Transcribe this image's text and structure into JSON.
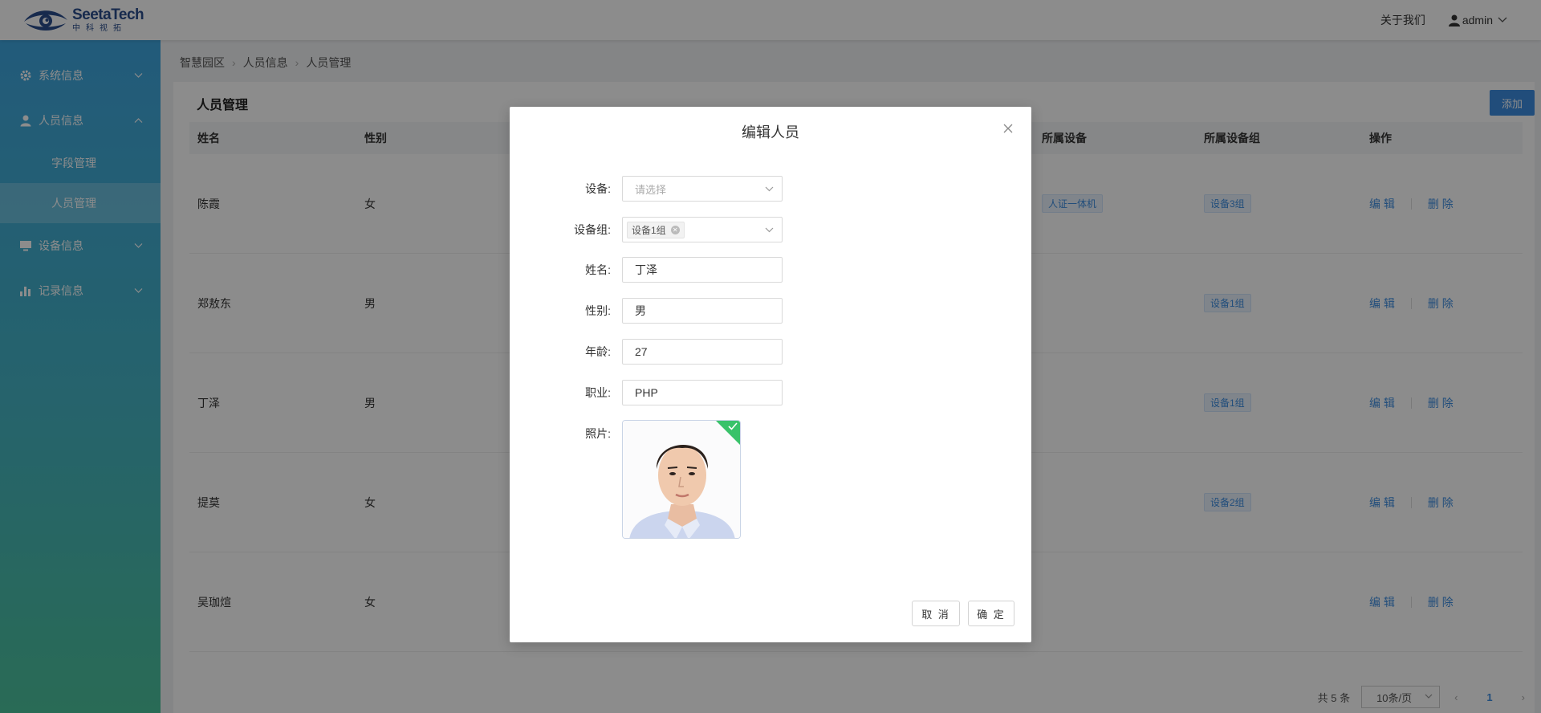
{
  "header": {
    "logo_name": "SeetaTech",
    "logo_sub": "中科视拓",
    "about": "关于我们",
    "user": "admin"
  },
  "sidebar": {
    "items": [
      {
        "label": "系统信息",
        "icon": "gear-icon"
      },
      {
        "label": "人员信息",
        "icon": "user-icon"
      },
      {
        "label": "设备信息",
        "icon": "monitor-icon"
      },
      {
        "label": "记录信息",
        "icon": "bar-chart-icon"
      }
    ],
    "sub_items": [
      {
        "label": "字段管理"
      },
      {
        "label": "人员管理"
      }
    ]
  },
  "breadcrumb": [
    "智慧园区",
    "人员信息",
    "人员管理"
  ],
  "page": {
    "title": "人员管理",
    "add_label": "添加"
  },
  "table": {
    "headers": {
      "name": "姓名",
      "gender": "性别",
      "device": "所属设备",
      "group": "所属设备组",
      "op": "操作"
    },
    "rows": [
      {
        "name": "陈霞",
        "gender": "女",
        "device": "人证一体机",
        "group": "设备3组"
      },
      {
        "name": "郑敖东",
        "gender": "男",
        "device": "",
        "group": "设备1组"
      },
      {
        "name": "丁泽",
        "gender": "男",
        "device": "",
        "group": "设备1组"
      },
      {
        "name": "提莫",
        "gender": "女",
        "device": "",
        "group": "设备2组"
      },
      {
        "name": "吴珈煊",
        "gender": "女",
        "device": "",
        "group": ""
      }
    ],
    "edit_label": "编 辑",
    "delete_label": "删 除"
  },
  "pagination": {
    "total": "共 5 条",
    "page_size": "10条/页",
    "current_page": "1"
  },
  "modal": {
    "title": "编辑人员",
    "fields": {
      "device": {
        "label": "设备:",
        "placeholder": "请选择"
      },
      "group": {
        "label": "设备组:",
        "chip": "设备1组"
      },
      "name": {
        "label": "姓名:",
        "value": "丁泽"
      },
      "gender": {
        "label": "性别:",
        "value": "男"
      },
      "age": {
        "label": "年龄:",
        "value": "27"
      },
      "job": {
        "label": "职业:",
        "value": "PHP"
      },
      "photo": {
        "label": "照片:"
      }
    },
    "cancel_label": "取 消",
    "ok_label": "确 定"
  },
  "colors": {
    "accent": "#3d8de0",
    "sidebar_top": "#3fa6df",
    "sidebar_bottom": "#4cc39c",
    "success": "#39c26a"
  }
}
